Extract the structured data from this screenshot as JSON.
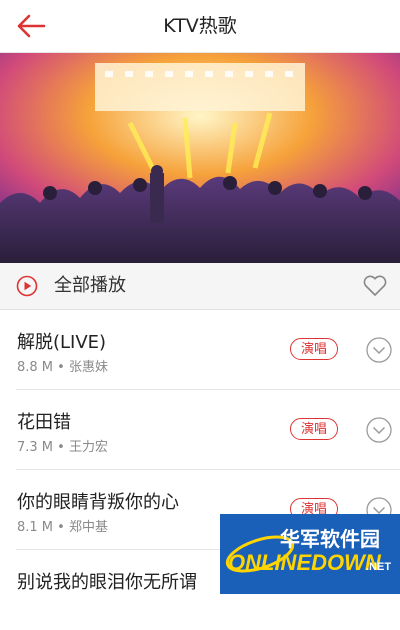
{
  "header": {
    "title": "KTV热歌",
    "back_icon": "back-arrow-icon"
  },
  "banner": {
    "image": "concert-crowd-stage-lights"
  },
  "play_all": {
    "label": "全部播放",
    "play_icon": "play-circle-icon",
    "favorite_icon": "heart-outline-icon"
  },
  "songs": [
    {
      "name": "解脱(LIVE)",
      "meta": "8.8 M • 张惠妹",
      "sing_label": "演唱"
    },
    {
      "name": "花田错",
      "meta": "7.3 M • 王力宏",
      "sing_label": "演唱"
    },
    {
      "name": "你的眼睛背叛你的心",
      "meta": "8.1 M • 郑中基",
      "sing_label": "演唱"
    },
    {
      "name": "别说我的眼泪你无所谓",
      "meta": "",
      "sing_label": ""
    }
  ],
  "watermark": {
    "cn_text": "华军软件园",
    "en_text": "ONLINEDOWN",
    "suffix": ".NET"
  },
  "colors": {
    "accent": "#d33333",
    "watermark_bg": "#1a5fb8",
    "watermark_text": "#ffd400"
  }
}
